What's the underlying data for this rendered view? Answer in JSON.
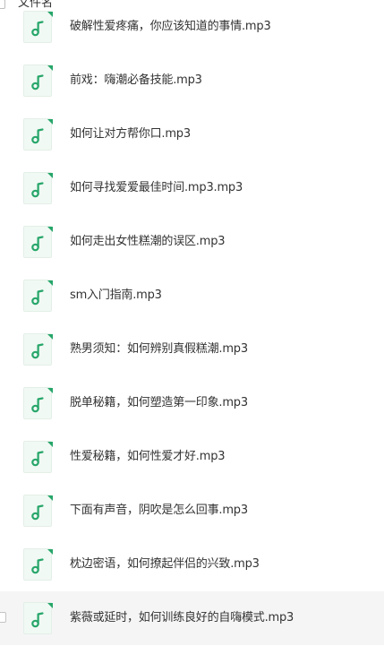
{
  "header": {
    "column_label": "文件名"
  },
  "files": [
    {
      "name": "破解性爱疼痛，你应该知道的事情.mp3",
      "icon": "music-note-icon",
      "hovered": false
    },
    {
      "name": "前戏：嗨潮必备技能.mp3",
      "icon": "music-note-icon",
      "hovered": false
    },
    {
      "name": "如何让对方帮你口.mp3",
      "icon": "music-note-icon",
      "hovered": false
    },
    {
      "name": "如何寻找爱爱最佳时间.mp3.mp3",
      "icon": "music-note-icon",
      "hovered": false
    },
    {
      "name": "如何走出女性糕潮的误区.mp3",
      "icon": "music-note-icon",
      "hovered": false
    },
    {
      "name": "sm入门指南.mp3",
      "icon": "music-note-icon",
      "hovered": false
    },
    {
      "name": "熟男须知：如何辨别真假糕潮.mp3",
      "icon": "music-note-icon",
      "hovered": false
    },
    {
      "name": "脱单秘籍，如何塑造第一印象.mp3",
      "icon": "music-note-icon",
      "hovered": false
    },
    {
      "name": "性爱秘籍，如何性爱才好.mp3",
      "icon": "music-note-icon",
      "hovered": false
    },
    {
      "name": "下面有声音，阴吹是怎么回事.mp3",
      "icon": "music-note-icon",
      "hovered": false
    },
    {
      "name": "枕边密语，如何撩起伴侣的兴致.mp3",
      "icon": "music-note-icon",
      "hovered": false
    },
    {
      "name": "紫薇或延时，如何训练良好的自嗨模式.mp3",
      "icon": "music-note-icon",
      "hovered": true
    }
  ],
  "colors": {
    "icon_green": "#27a66a",
    "icon_bg": "#f1f9f4",
    "hover_bg": "#f5f5f6",
    "text": "#333333"
  }
}
